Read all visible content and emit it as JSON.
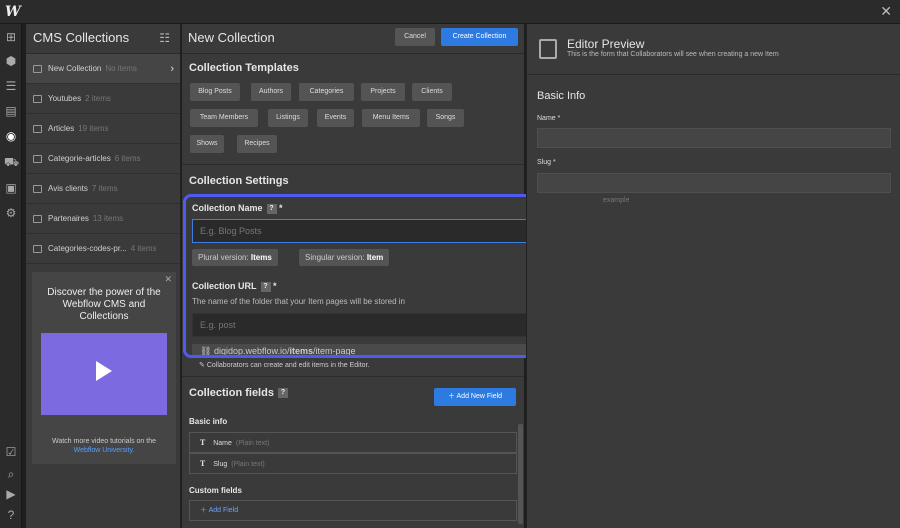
{
  "app": {
    "logo": "W"
  },
  "collections_panel": {
    "title": "CMS Collections",
    "items": [
      {
        "name": "New Collection",
        "count": "No items"
      },
      {
        "name": "Youtubes",
        "count": "2 items"
      },
      {
        "name": "Articles",
        "count": "19 items"
      },
      {
        "name": "Categorie-articles",
        "count": "6 items"
      },
      {
        "name": "Avis clients",
        "count": "7 items"
      },
      {
        "name": "Partenaires",
        "count": "13 items"
      },
      {
        "name": "Categories-codes-pr...",
        "count": "4 items"
      }
    ],
    "promo": {
      "title": "Discover the power of the Webflow CMS and Collections",
      "text": "Watch more video tutorials on the",
      "link": "Webflow University."
    }
  },
  "main": {
    "title": "New Collection",
    "cancel_label": "Cancel",
    "create_label": "Create Collection",
    "templates_title": "Collection Templates",
    "templates": [
      "Blog Posts",
      "Authors",
      "Categories",
      "Projects",
      "Clients",
      "Team Members",
      "Listings",
      "Events",
      "Menu Items",
      "Songs",
      "Shows",
      "Recipes"
    ],
    "settings_title": "Collection Settings",
    "collection_name_label": "Collection Name",
    "collection_name_placeholder": "E.g. Blog Posts",
    "plural_label": "Plural version:",
    "plural_value": "Items",
    "singular_label": "Singular version:",
    "singular_value": "Item",
    "url_label": "Collection URL",
    "url_desc": "The name of the folder that your Item pages will be stored in",
    "url_placeholder": "E.g. post",
    "url_preview_prefix": "digidop.webflow.io/",
    "url_preview_bold": "items",
    "url_preview_suffix": "/item-page",
    "collaborators_note": "Collaborators can create and edit items in the Editor.",
    "fields_title": "Collection fields",
    "add_new_field": "Add New Field",
    "basic_info_title": "Basic info",
    "basic_fields": [
      {
        "name": "Name",
        "type": "(Plain text)"
      },
      {
        "name": "Slug",
        "type": "(Plain text)"
      }
    ],
    "custom_fields_title": "Custom fields",
    "add_field": "Add Field",
    "field_type_glyph": "T"
  },
  "preview": {
    "title": "Editor Preview",
    "subtitle": "This is the form that Collaborators will see when creating a new Item",
    "section": "Basic Info",
    "name_label": "Name *",
    "slug_label": "Slug *",
    "slug_hint": "example"
  }
}
